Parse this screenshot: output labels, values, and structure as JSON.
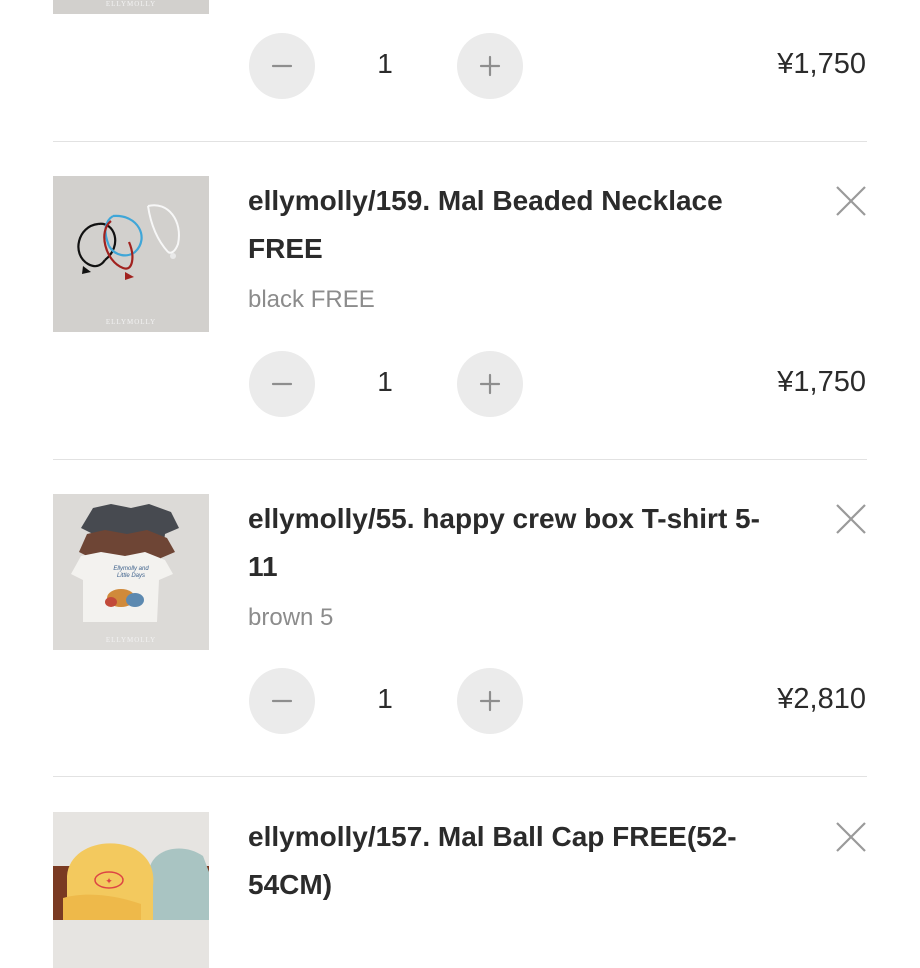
{
  "cart": {
    "top_partial": {
      "thumb_brand": "ELLYMOLLY",
      "quantity": "1",
      "price": "¥1,750"
    },
    "items": [
      {
        "title_line1": "ellymolly/159. Mal Beaded Necklace",
        "title_line2": "FREE",
        "variant": "black FREE",
        "quantity": "1",
        "price": "¥1,750",
        "thumb_brand": "ELLYMOLLY"
      },
      {
        "title_line1": "ellymolly/55. happy crew box T-shirt 5-",
        "title_line2": "11",
        "variant": "brown 5",
        "quantity": "1",
        "price": "¥2,810",
        "thumb_brand": "ELLYMOLLY",
        "thumb_print_text": "Ellymolly and Little Days"
      },
      {
        "title_line1": "ellymolly/157. Mal Ball Cap FREE(52-",
        "title_line2": "54CM)"
      }
    ]
  },
  "icons": {
    "minus": "minus-icon",
    "plus": "plus-icon",
    "remove": "close-icon"
  },
  "colors": {
    "button_bg": "#ebebeb",
    "text": "#2b2b2b",
    "muted": "#8c8c8c",
    "divider": "#e2e2e2"
  }
}
